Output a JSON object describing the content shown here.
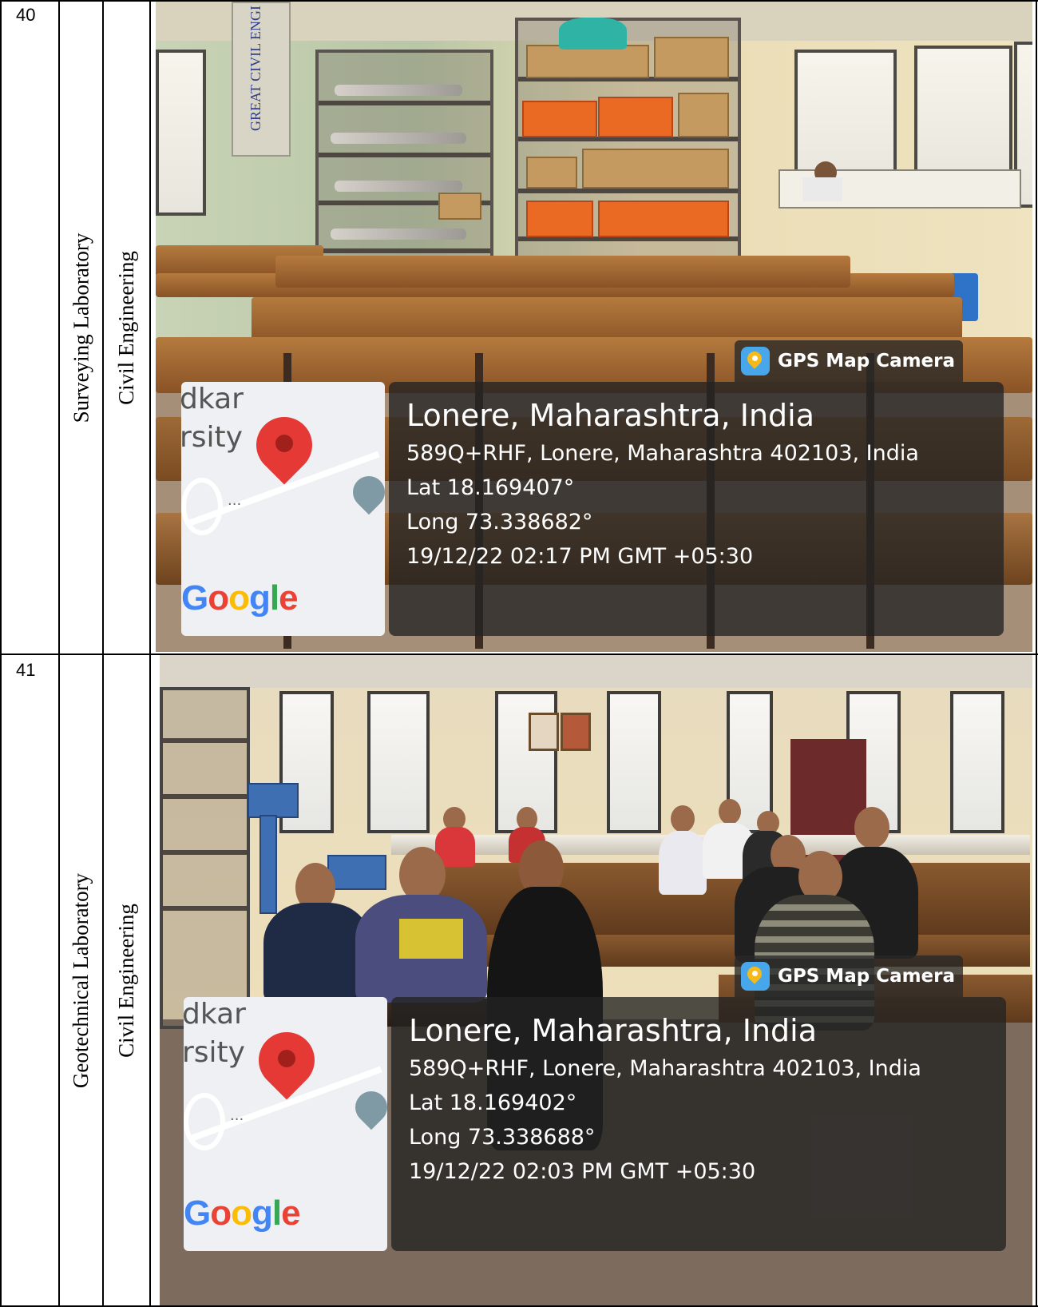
{
  "rows": [
    {
      "sno": "40",
      "lab": "Surveying Laboratory",
      "department": "Civil Engineering",
      "photo": {
        "banner_text": "GREAT CIVIL ENGI",
        "gps_tag": "GPS Map Camera",
        "location_title": "Lonere, Maharashtra, India",
        "address": "589Q+RHF, Lonere, Maharashtra 402103, India",
        "lat": "Lat 18.169407°",
        "long": "Long 73.338682°",
        "datetime": "19/12/22 02:17 PM GMT +05:30",
        "map_text_1": "dkar",
        "map_text_2": "rsity",
        "map_dots": "...",
        "map_logo": "Google"
      }
    },
    {
      "sno": "41",
      "lab": "Geotechnical Laboratory",
      "department": "Civil Engineering",
      "photo": {
        "gps_tag": "GPS Map Camera",
        "location_title": "Lonere, Maharashtra, India",
        "address": "589Q+RHF, Lonere, Maharashtra 402103, India",
        "lat": "Lat 18.169402°",
        "long": "Long 73.338688°",
        "datetime": "19/12/22 02:03 PM GMT +05:30",
        "map_text_1": "dkar",
        "map_text_2": "rsity",
        "map_dots": "...",
        "map_logo": "Google"
      }
    }
  ],
  "colors": {
    "map_pin": "#e53935",
    "gps_icon": "#48a7ea",
    "overlay": "rgba(35,35,35,0.78)"
  },
  "icons": [
    "gps-map-camera-icon",
    "map-pin-icon",
    "location-marker-icon"
  ]
}
